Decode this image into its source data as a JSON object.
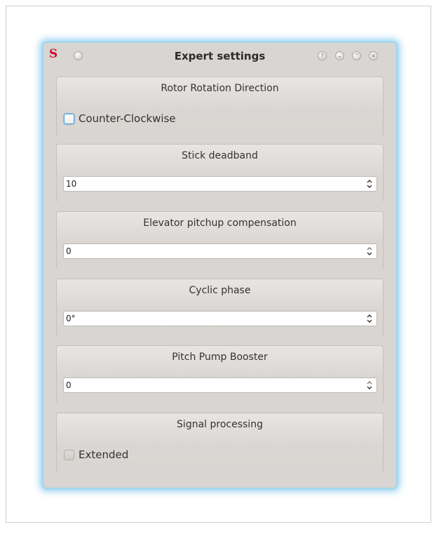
{
  "window": {
    "title": "Expert settings",
    "logo_glyph": "S",
    "help_glyph": "?",
    "minimize_glyph": "⌄",
    "maximize_glyph": "⌃",
    "close_glyph": "×"
  },
  "groups": {
    "rotor": {
      "title": "Rotor Rotation Direction",
      "checkbox_label": "Counter-Clockwise",
      "checked": false
    },
    "stick": {
      "title": "Stick deadband",
      "value": "10"
    },
    "elevator": {
      "title": "Elevator pitchup compensation",
      "value": "0"
    },
    "cyclic": {
      "title": "Cyclic phase",
      "value": "0°"
    },
    "pitch_pump": {
      "title": "Pitch Pump Booster",
      "value": "0"
    },
    "signal": {
      "title": "Signal processing",
      "checkbox_label": "Extended",
      "checked": false
    }
  },
  "icons": {
    "logo": "app-logo-icon",
    "window_menu": "window-menu-icon",
    "help": "help-icon",
    "minimize": "minimize-icon",
    "maximize": "maximize-icon",
    "close": "close-icon",
    "spin": "spin-arrows-icon"
  },
  "colors": {
    "dialog_bg": "#d9d5d2",
    "glow": "#9fd6ef",
    "logo": "#c8102e",
    "focus": "#4a9ed0"
  }
}
